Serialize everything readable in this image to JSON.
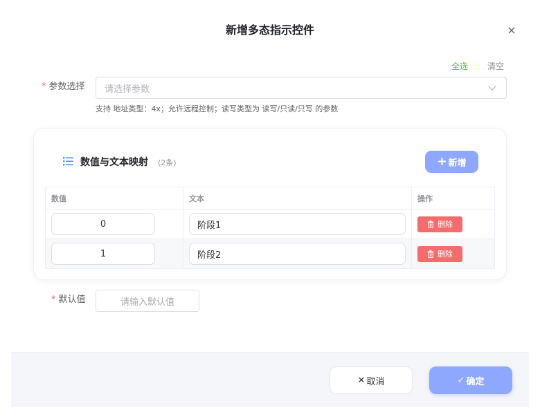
{
  "dialog": {
    "title": "新增多态指示控件",
    "close_icon": "×"
  },
  "param_select": {
    "select_all": "全选",
    "clear": "清空",
    "required_mark": "*",
    "label": "参数选择",
    "placeholder": "请选择参数",
    "hint": "支持 地址类型：4x；允许远程控制；读写类型为 读写/只读/只写 的参数"
  },
  "mapping": {
    "title": "数值与文本映射",
    "count": "(2条)",
    "add_plus": "+",
    "add_label": "新增",
    "columns": [
      "数值",
      "文本",
      "操作"
    ],
    "rows": [
      {
        "value": "0",
        "text": "阶段1",
        "delete_label": "删除"
      },
      {
        "value": "1",
        "text": "阶段2",
        "delete_label": "删除"
      }
    ]
  },
  "default_value": {
    "required_mark": "*",
    "label": "默认值",
    "placeholder": "请输入默认值"
  },
  "footer": {
    "cancel_glyph": "✕",
    "cancel_label": "取消",
    "confirm_glyph": "✓",
    "confirm_label": "确定"
  },
  "colors": {
    "accent": "#8fa8ff",
    "select_all": "#52c41a",
    "danger": "#f56c6c",
    "list_icon": "#4d8cff"
  }
}
